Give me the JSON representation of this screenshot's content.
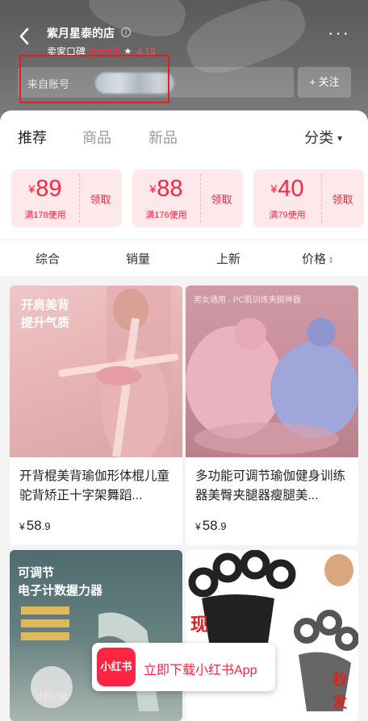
{
  "header": {
    "shop_name": "紫月星泰的店",
    "rating_label": "卖家口碑",
    "rating_stars": "★★★★",
    "rating_star_empty": "★",
    "rating_score": "4.19",
    "source_label": "来自账号",
    "follow_label": "+ 关注",
    "more_label": "···"
  },
  "tabs": [
    {
      "label": "推荐",
      "active": true
    },
    {
      "label": "商品",
      "active": false
    },
    {
      "label": "新品",
      "active": false
    }
  ],
  "category_label": "分类",
  "coupons": [
    {
      "currency": "¥",
      "amount": "89",
      "condition": "满178使用",
      "claim": "领取"
    },
    {
      "currency": "¥",
      "amount": "88",
      "condition": "满176使用",
      "claim": "领取"
    },
    {
      "currency": "¥",
      "amount": "40",
      "condition": "满79使用",
      "claim": "领取"
    }
  ],
  "sort_options": [
    "综合",
    "销量",
    "上新",
    "价格"
  ],
  "products": [
    {
      "title": "开背棍美背瑜伽形体棍儿童驼背矫正十字架舞蹈...",
      "currency": "¥",
      "price_int": "58",
      "price_dec": ".9",
      "image_text": [
        "开肩美背",
        "提升气质"
      ]
    },
    {
      "title": "多功能可调节瑜伽健身训练器美臀夹腿器瘦腿美...",
      "currency": "¥",
      "price_int": "58",
      "price_dec": ".9",
      "image_text": [
        "男女通用 · PC肌训练夹腿神器"
      ]
    },
    {
      "title": "",
      "image_text": [
        "可调节",
        "电子计数握力器",
        "计数功能"
      ]
    },
    {
      "title": "",
      "image_text": [
        "现",
        "秒",
        "发"
      ]
    }
  ],
  "download_bar": {
    "logo": "小红书",
    "text": "立即下载小红书App"
  },
  "colors": {
    "brand": "#ff2442",
    "coupon_bg": "#fde8ea"
  }
}
